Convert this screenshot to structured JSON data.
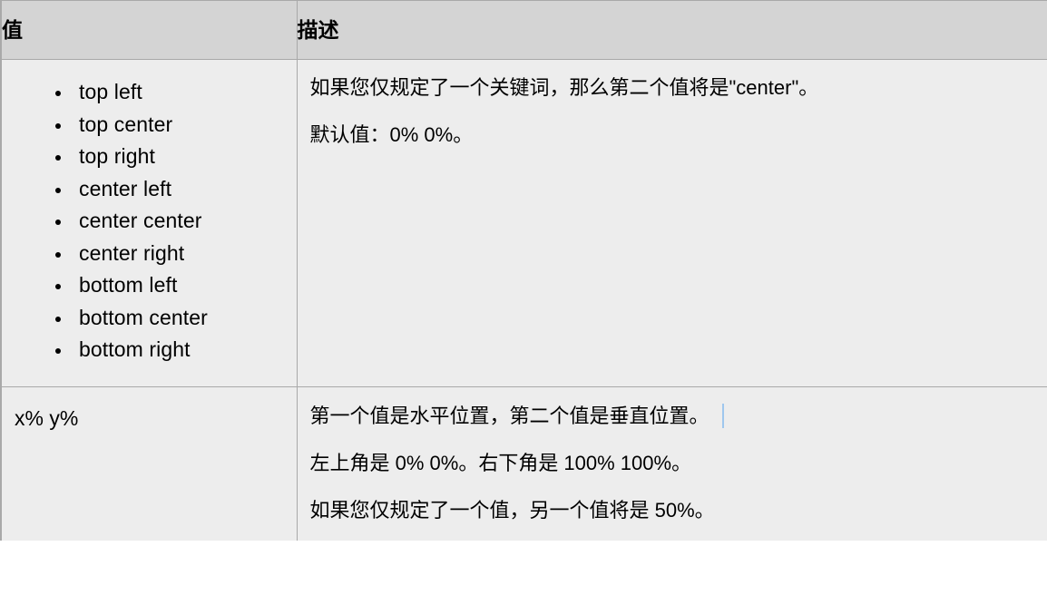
{
  "table": {
    "headers": {
      "value": "值",
      "description": "描述"
    },
    "rows": [
      {
        "value_type": "list",
        "value_items": [
          "top left",
          "top center",
          "top right",
          "center left",
          "center center",
          "center right",
          "bottom left",
          "bottom center",
          "bottom right"
        ],
        "description_paragraphs": [
          "如果您仅规定了一个关键词，那么第二个值将是\"center\"。",
          "默认值：0% 0%。"
        ]
      },
      {
        "value_type": "text",
        "value_text": "x% y%",
        "description_paragraphs": [
          "第一个值是水平位置，第二个值是垂直位置。",
          "左上角是 0% 0%。右下角是 100% 100%。",
          "如果您仅规定了一个值，另一个值将是 50%。"
        ]
      }
    ]
  },
  "colors": {
    "header_background": "#d4d4d4",
    "body_background": "#ededed",
    "border": "#a9a9a9",
    "text": "#000000",
    "caret": "#9fc7ee"
  }
}
